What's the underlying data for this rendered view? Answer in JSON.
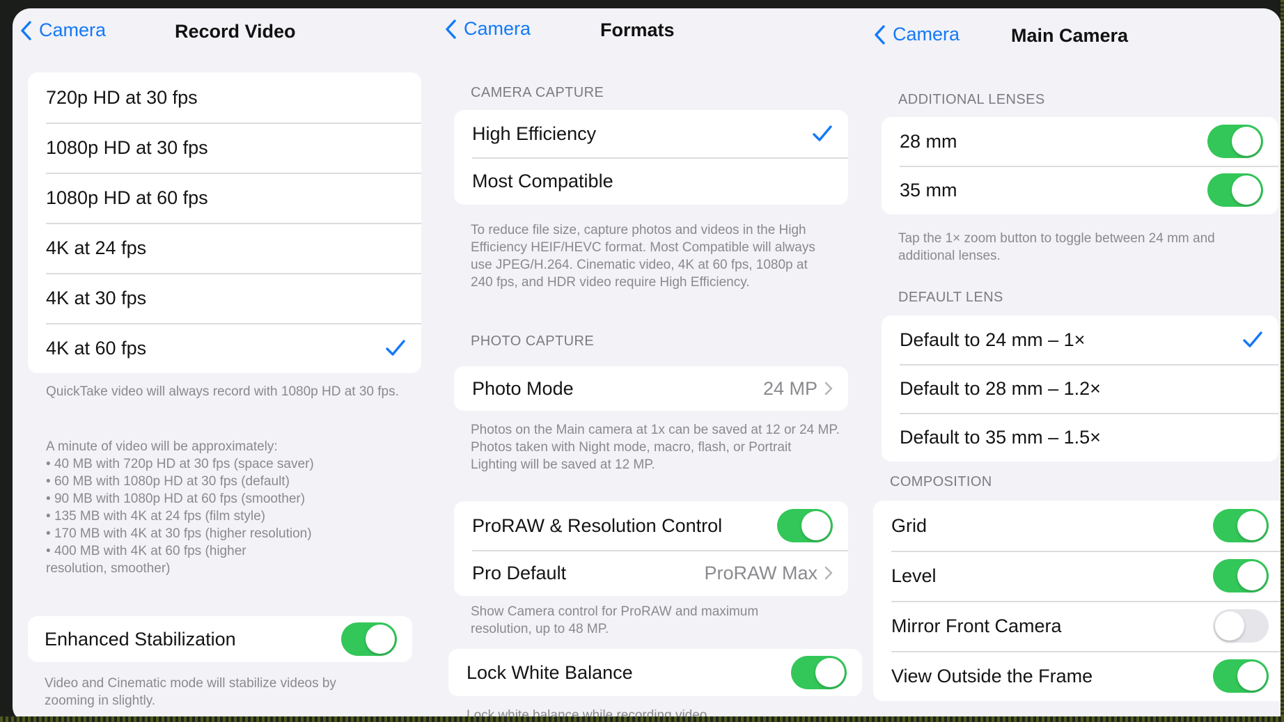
{
  "record_video": {
    "back_label": "Camera",
    "title": "Record Video",
    "options": [
      {
        "label": "720p HD at 30 fps",
        "selected": false
      },
      {
        "label": "1080p HD at 30 fps",
        "selected": false
      },
      {
        "label": "1080p HD at 60 fps",
        "selected": false
      },
      {
        "label": "4K at 24 fps",
        "selected": false
      },
      {
        "label": "4K at 30 fps",
        "selected": false
      },
      {
        "label": "4K at 60 fps",
        "selected": true
      }
    ],
    "quicktake_note": "QuickTake video will always record with 1080p HD at 30 fps.",
    "size_intro": "A minute of video will be approximately:",
    "size_items": [
      "40 MB with 720p HD at 30 fps (space saver)",
      "60 MB with 1080p HD at 30 fps (default)",
      "90 MB with 1080p HD at 60 fps (smoother)",
      "135 MB with 4K at 24 fps (film style)",
      "170 MB with 4K at 30 fps (higher resolution)",
      "400 MB with 4K at 60 fps (higher resolution, smoother)"
    ],
    "stabilization_label": "Enhanced Stabilization",
    "stabilization_on": true,
    "stabilization_note": "Video and Cinematic mode will stabilize videos by zooming in slightly."
  },
  "formats": {
    "back_label": "Camera",
    "title": "Formats",
    "camera_capture_header": "CAMERA CAPTURE",
    "capture_options": [
      {
        "label": "High Efficiency",
        "selected": true
      },
      {
        "label": "Most Compatible",
        "selected": false
      }
    ],
    "capture_note": "To reduce file size, capture photos and videos in the High Efficiency HEIF/HEVC format. Most Compatible will always use JPEG/H.264. Cinematic video, 4K at 60 fps, 1080p at 240 fps, and HDR video require High Efficiency.",
    "photo_capture_header": "PHOTO CAPTURE",
    "photo_mode_label": "Photo Mode",
    "photo_mode_value": "24 MP",
    "photo_note": "Photos on the Main camera at 1x can be saved at 12 or 24 MP. Photos taken with Night mode, macro, flash, or Portrait Lighting will be saved at 12 MP.",
    "proraw_label": "ProRAW & Resolution Control",
    "proraw_on": true,
    "pro_default_label": "Pro Default",
    "pro_default_value": "ProRAW Max",
    "proraw_note": "Show Camera control for ProRAW and maximum resolution, up to 48 MP.",
    "lock_wb_label": "Lock White Balance",
    "lock_wb_on": true,
    "lock_wb_note": "Lock white balance while recording video."
  },
  "main_camera": {
    "back_label": "Camera",
    "title": "Main Camera",
    "additional_lenses_header": "ADDITIONAL LENSES",
    "lenses": [
      {
        "label": "28 mm",
        "on": true
      },
      {
        "label": "35 mm",
        "on": true
      }
    ],
    "lenses_note": "Tap the 1× zoom button to toggle between 24 mm and additional lenses.",
    "default_lens_header": "DEFAULT LENS",
    "default_lens_options": [
      {
        "label": "Default to 24 mm – 1×",
        "selected": true
      },
      {
        "label": "Default to 28 mm – 1.2×",
        "selected": false
      },
      {
        "label": "Default to 35 mm – 1.5×",
        "selected": false
      }
    ],
    "composition_header": "COMPOSITION",
    "composition": [
      {
        "label": "Grid",
        "on": true
      },
      {
        "label": "Level",
        "on": true
      },
      {
        "label": "Mirror Front Camera",
        "on": false
      },
      {
        "label": "View Outside the Frame",
        "on": true
      }
    ]
  },
  "colors": {
    "accent": "#1479f7",
    "toggle_on": "#33c759",
    "toggle_off": "#e6e6ea",
    "background": "#f2f2f7"
  },
  "icons": [
    "chevron-left-icon",
    "checkmark-icon",
    "chevron-right-icon"
  ]
}
